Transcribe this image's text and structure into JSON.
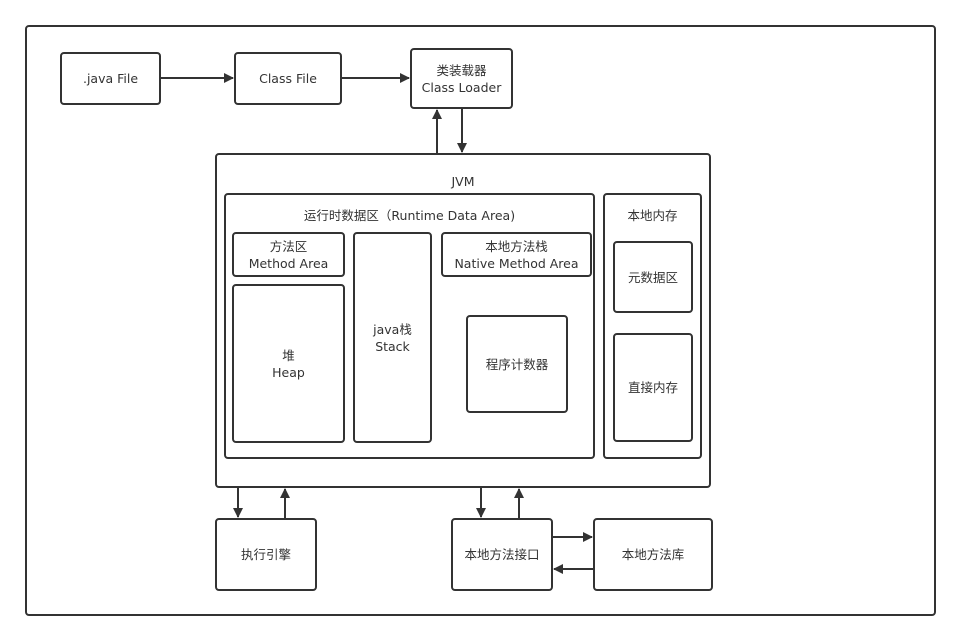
{
  "diagram": {
    "java_file": ".java File",
    "class_file": "Class File",
    "class_loader": {
      "line1": "类装载器",
      "line2": "Class Loader"
    },
    "jvm": {
      "title": "JVM",
      "runtime_data_area": {
        "title": "运行时数据区（Runtime Data Area)",
        "method_area": {
          "line1": "方法区",
          "line2": "Method Area"
        },
        "heap": {
          "line1": "堆",
          "line2": "Heap"
        },
        "stack": {
          "line1": "java栈",
          "line2": "Stack"
        },
        "native_method_stack": {
          "line1": "本地方法栈",
          "line2": "Native Method Area"
        },
        "program_counter": "程序计数器"
      },
      "native_memory": {
        "title": "本地内存",
        "metaspace": "元数据区",
        "direct_memory": "直接内存"
      }
    },
    "execution_engine": "执行引擎",
    "native_interface": "本地方法接口",
    "native_library": "本地方法库"
  }
}
